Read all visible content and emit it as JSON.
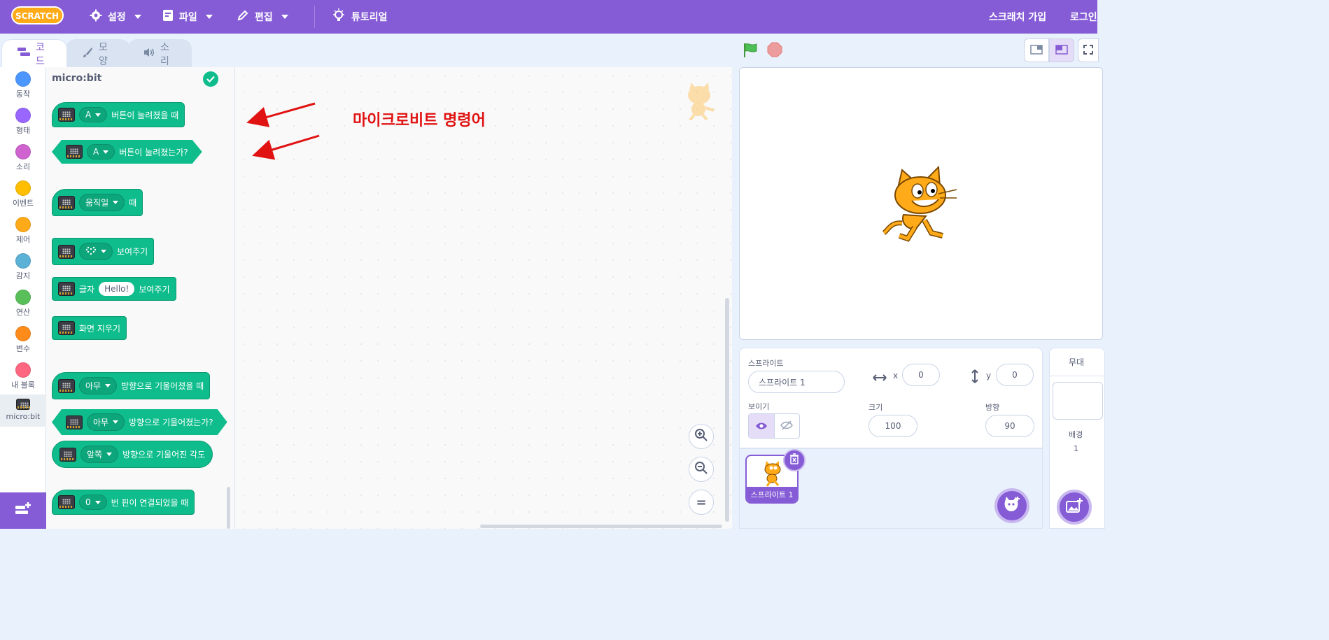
{
  "menubar": {
    "logo_text": "SCRATCH",
    "settings": "설정",
    "file": "파일",
    "edit": "편집",
    "tutorials": "튜토리얼",
    "join": "스크래치 가입",
    "signin": "로그인"
  },
  "tabs": {
    "code": "코드",
    "costumes": "모양",
    "sounds": "소리"
  },
  "categories": [
    {
      "label": "동작",
      "color": "#4c97ff"
    },
    {
      "label": "형태",
      "color": "#9966ff"
    },
    {
      "label": "소리",
      "color": "#cf63cf"
    },
    {
      "label": "이벤트",
      "color": "#ffbf00"
    },
    {
      "label": "제어",
      "color": "#ffab19"
    },
    {
      "label": "감지",
      "color": "#5cb1d6"
    },
    {
      "label": "연산",
      "color": "#59c059"
    },
    {
      "label": "변수",
      "color": "#ff8c1a"
    },
    {
      "label": "내 블록",
      "color": "#ff6680"
    },
    {
      "label": "micro:bit",
      "color": ""
    }
  ],
  "palette": {
    "title": "micro:bit",
    "blocks": {
      "when_button_value": "A",
      "when_button_text": "버튼이 눌려졌을 때",
      "is_button_value": "A",
      "is_button_text": "버튼이 눌려졌는가?",
      "when_gesture_value": "움직일",
      "when_gesture_text": "때",
      "display_image_text": "보여주기",
      "display_text_prefix": "글자",
      "display_text_value": "Hello!",
      "display_text_suffix": "보여주기",
      "clear_text": "화면 지우기",
      "when_tilted_value": "아무",
      "when_tilted_text": "방향으로 기울어졌을 때",
      "is_tilted_value": "아무",
      "is_tilted_text": "방향으로 기울어졌는가?",
      "tilt_angle_value": "앞쪽",
      "tilt_angle_text": "방향으로 기울어진 각도",
      "when_pin_value": "0",
      "when_pin_text": "번 핀이 연결되었을 때"
    }
  },
  "workspace": {
    "annotation": "마이크로비트 명령어",
    "zoom_reset": "="
  },
  "sprite": {
    "sprite_label": "스프라이트",
    "sprite_name": "스프라이트 1",
    "x_label": "x",
    "x_value": "0",
    "y_label": "y",
    "y_value": "0",
    "show_label": "보이기",
    "size_label": "크기",
    "size_value": "100",
    "direction_label": "방향",
    "direction_value": "90",
    "thumb_name": "스프라이트 1"
  },
  "stage_panel": {
    "title": "무대",
    "backdrops_label": "배경",
    "backdrops_count": "1"
  },
  "colors": {
    "accent": "#855cd6",
    "microbit_block": "#0fbd8c"
  }
}
